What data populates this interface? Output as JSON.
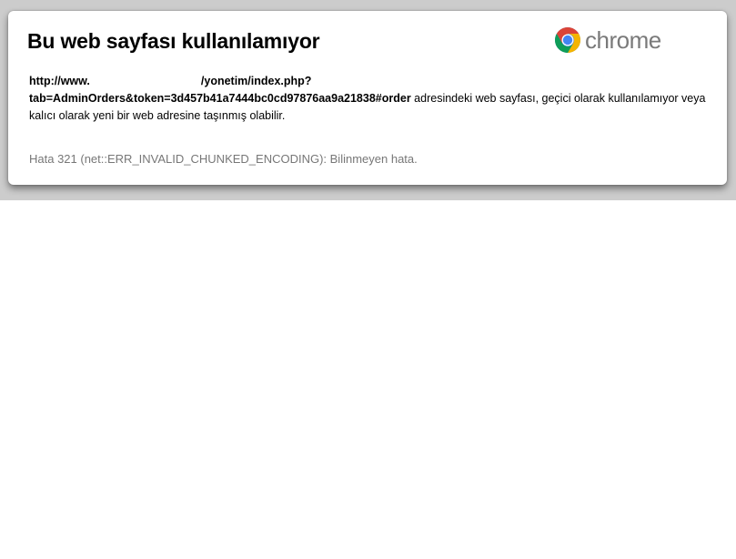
{
  "error": {
    "title": "Bu web sayfası kullanılamıyor",
    "url_part1": "http://www.",
    "url_part2": "/yonetim/index.php?",
    "url_part3": "tab=AdminOrders&token=3d457b41a7444bc0cd97876aa9a21838#order",
    "message": " adresindeki web sayfası, geçici olarak kullanılamıyor veya kalıcı olarak yeni bir web adresine taşınmış olabilir.",
    "code": "Hata 321 (net::ERR_INVALID_CHUNKED_ENCODING): Bilinmeyen hata."
  },
  "logo": {
    "text": "chrome",
    "icon": "chrome-logo-icon",
    "colors": {
      "red": "#db4437",
      "green": "#0f9d58",
      "yellow": "#f4b400",
      "blue": "#4285f4"
    }
  },
  "colors": {
    "background_band": "#cccccc",
    "error_code_text": "#777777"
  }
}
